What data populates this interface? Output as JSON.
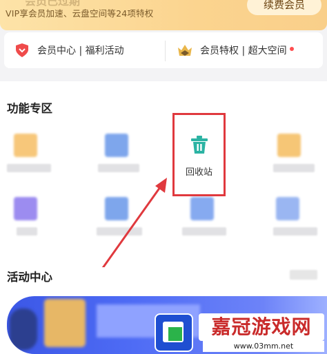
{
  "vip": {
    "title": "会员已过期",
    "subtitle": "VIP享会员加速、云盘空间等24项特权",
    "renew_label": "续费会员"
  },
  "perks": {
    "left_label": "会员中心 | 福利活动",
    "right_label": "会员特权 | 超大空间",
    "left_icon": "heart-badge-icon",
    "right_icon": "crown-icon"
  },
  "features": {
    "title": "功能专区",
    "recycle_label": "回收站",
    "recycle_icon": "trash-icon",
    "recycle_color": "#2bb3a3",
    "highlight_color": "#e0393e"
  },
  "activity": {
    "title": "活动中心"
  },
  "watermark": {
    "text": "嘉冠游戏网",
    "url": "www.03mm.net"
  }
}
